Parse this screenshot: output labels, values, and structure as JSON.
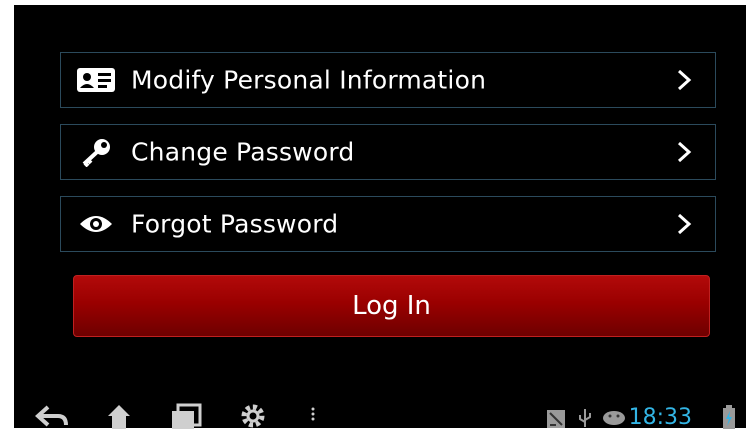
{
  "menu": {
    "items": [
      {
        "label": "Modify Personal Information",
        "icon": "id-card-icon"
      },
      {
        "label": "Change Password",
        "icon": "key-icon"
      },
      {
        "label": "Forgot Password",
        "icon": "eye-icon"
      }
    ]
  },
  "login": {
    "label": "Log In"
  },
  "status_bar": {
    "time": "18:33"
  },
  "colors": {
    "accent": "#33b5e5",
    "button": "#9a0000",
    "row_border": "#2b4a5c"
  }
}
